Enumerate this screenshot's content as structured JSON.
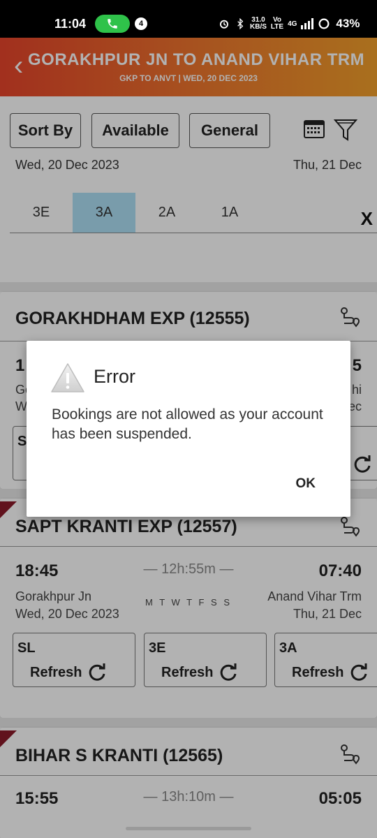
{
  "status_bar": {
    "time": "11:04",
    "notification_count": "4",
    "speed_top": "31.0",
    "speed_bottom": "KB/S",
    "network": "4G",
    "battery": "43%"
  },
  "header": {
    "title": "GORAKHPUR JN TO ANAND VIHAR TRM",
    "subtitle": "GKP TO ANVT | WED, 20 DEC 2023"
  },
  "filters": {
    "sort_label": "Sort By",
    "available_label": "Available",
    "general_label": "General",
    "date_left": "Wed, 20 Dec 2023",
    "date_right": "Thu, 21 Dec",
    "classes": [
      "3E",
      "3A",
      "2A",
      "1A"
    ],
    "selected_class": "3A",
    "close_label": "X"
  },
  "trains": [
    {
      "name": "GORAKHDHAM EXP (12555)",
      "dep_time": "1",
      "arr_time": "5",
      "from_partial": "Go",
      "from_date_partial": "W",
      "to_partial": "hi",
      "to_date_partial": "ec",
      "class_partial": "S"
    },
    {
      "name": "SAPT KRANTI EXP (12557)",
      "dep_time": "18:45",
      "duration": "— 12h:55m —",
      "arr_time": "07:40",
      "from": "Gorakhpur Jn",
      "days": "M T W T F S S",
      "to": "Anand Vihar Trm",
      "from_date": "Wed, 20 Dec 2023",
      "to_date": "Thu, 21 Dec",
      "classes": [
        {
          "name": "SL",
          "action": "Refresh"
        },
        {
          "name": "3E",
          "action": "Refresh"
        },
        {
          "name": "3A",
          "action": "Refresh"
        }
      ]
    },
    {
      "name": "BIHAR S KRANTI (12565)",
      "dep_time": "15:55",
      "duration": "— 13h:10m —",
      "arr_time": "05:05"
    }
  ],
  "dialog": {
    "title": "Error",
    "message": "Bookings are not allowed as your account has been suspended.",
    "ok_label": "OK"
  },
  "colors": {
    "header_start": "#e8452c",
    "header_end": "#f3a02c",
    "active_tab": "#aee0f5",
    "ribbon": "#8b1a2a",
    "call_pill": "#2fc24a"
  }
}
